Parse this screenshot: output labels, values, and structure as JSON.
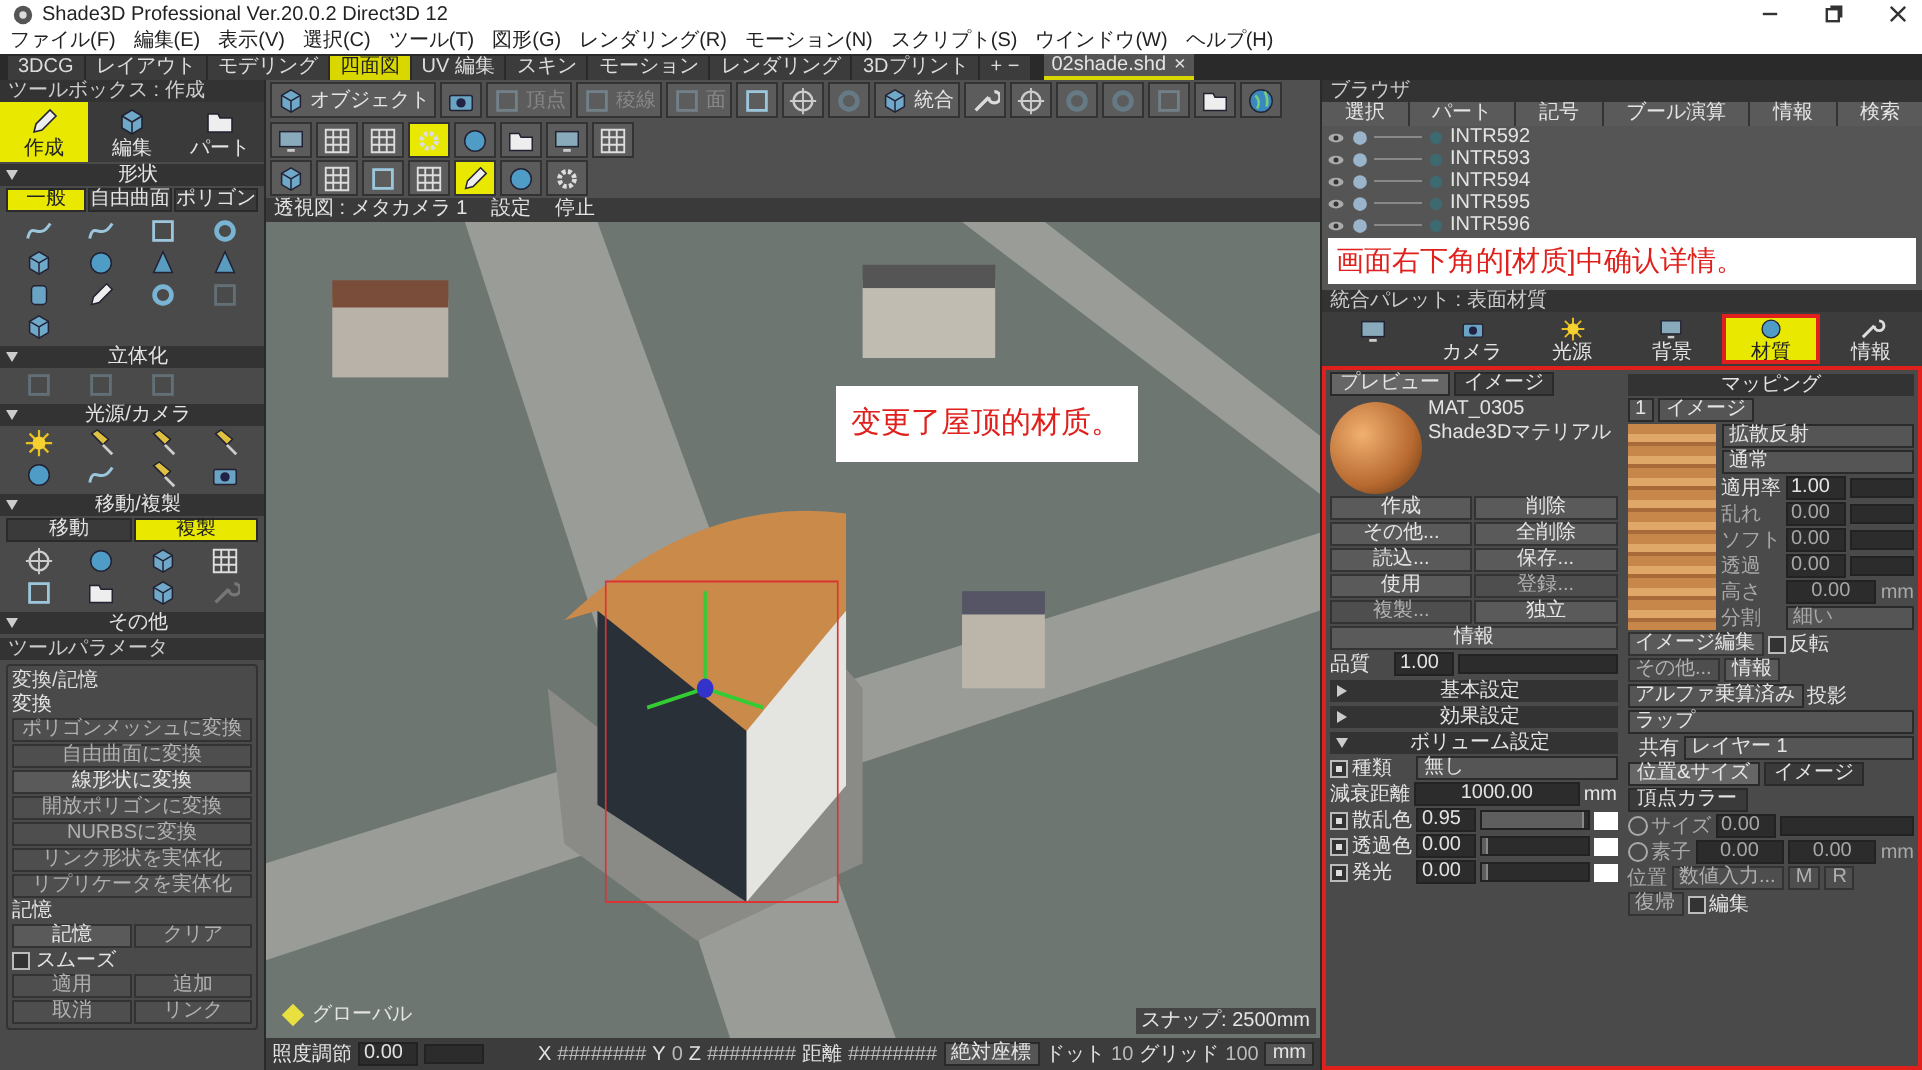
{
  "window": {
    "title": "Shade3D Professional Ver.20.0.2 Direct3D 12"
  },
  "menu": [
    "ファイル(F)",
    "編集(E)",
    "表示(V)",
    "選択(C)",
    "ツール(T)",
    "図形(G)",
    "レンダリング(R)",
    "モーション(N)",
    "スクリプト(S)",
    "ウインドウ(W)",
    "ヘルプ(H)"
  ],
  "mode_tabs": [
    {
      "label": "3DCG",
      "selected": false
    },
    {
      "label": "レイアウト",
      "selected": false
    },
    {
      "label": "モデリング",
      "selected": false
    },
    {
      "label": "四面図",
      "selected": true
    },
    {
      "label": "UV 編集",
      "selected": false
    },
    {
      "label": "スキン",
      "selected": false
    },
    {
      "label": "モーション",
      "selected": false
    },
    {
      "label": "レンダリング",
      "selected": false
    },
    {
      "label": "3Dプリント",
      "selected": false
    }
  ],
  "tab_controls": "+ −",
  "document_tab": {
    "label": "02shade.shd",
    "close": "×"
  },
  "toolbar": {
    "row_1": [
      {
        "label": "オブジェクト",
        "selected": false,
        "disabled": false
      },
      {
        "selected": false,
        "disabled": false
      },
      {
        "label": "頂点",
        "selected": false,
        "disabled": true
      },
      {
        "label": "稜線",
        "selected": false,
        "disabled": true
      },
      {
        "label": "面",
        "selected": false,
        "disabled": true
      },
      {
        "selected": false,
        "disabled": false
      },
      {
        "selected": false,
        "disabled": false
      },
      {
        "selected": false,
        "disabled": true
      },
      {
        "label": "統合",
        "selected": false,
        "disabled": false
      },
      {
        "selected": false,
        "disabled": false
      },
      {
        "selected": false,
        "disabled": false
      },
      {
        "selected": false,
        "disabled": true
      },
      {
        "selected": false,
        "disabled": true
      },
      {
        "selected": false,
        "disabled": true
      },
      {
        "selected": false,
        "disabled": false
      },
      {
        "selected": false,
        "disabled": false
      },
      {
        "selected": false,
        "disabled": false
      },
      {
        "selected": false,
        "disabled": false
      },
      {
        "selected": false,
        "disabled": false
      },
      {
        "selected": true,
        "disabled": false
      },
      {
        "selected": false,
        "disabled": false
      },
      {
        "selected": false,
        "disabled": false
      },
      {
        "selected": false,
        "disabled": false
      },
      {
        "selected": false,
        "disabled": false
      }
    ],
    "row_2": [
      {
        "selected": false,
        "disabled": false
      },
      {
        "selected": false,
        "disabled": false
      },
      {
        "selected": false,
        "disabled": false
      },
      {
        "selected": false,
        "disabled": false
      },
      {
        "selected": true,
        "disabled": false
      },
      {
        "selected": false,
        "disabled": false
      },
      {
        "selected": false,
        "disabled": false
      }
    ]
  },
  "viewport": {
    "header": [
      "透視図 : メタカメラ 1",
      "設定",
      "停止"
    ],
    "callout": "变更了屋顶的材质。",
    "axis_label": "グローバル",
    "snap": "スナップ: 2500mm"
  },
  "status_bar": {
    "label": "照度調節",
    "value": "0.00",
    "coords": [
      {
        "label": "X",
        "value": "########"
      },
      {
        "label": "Y",
        "value": "0"
      },
      {
        "label": "Z",
        "value": "########"
      },
      {
        "label": "距離",
        "value": "########"
      }
    ],
    "mode": "絶対座標",
    "dot_label": "ドット",
    "dot_value": "10",
    "grid_label": "グリッド",
    "grid_value": "100",
    "unit": "mm"
  },
  "toolbox": {
    "title": "ツールボックス : 作成",
    "tabs": [
      {
        "label": "作成",
        "selected": true
      },
      {
        "label": "編集",
        "selected": false
      },
      {
        "label": "パート",
        "selected": false
      }
    ],
    "sections": [
      {
        "title": "形状",
        "expanded": true,
        "subtabs": [
          {
            "label": "一般",
            "selected": true
          },
          {
            "label": "自由曲面",
            "selected": false
          },
          {
            "label": "ポリゴン",
            "selected": false
          }
        ],
        "icons": [
          {
            "disabled": false
          },
          {
            "disabled": false
          },
          {
            "disabled": false
          },
          {
            "disabled": false
          },
          {
            "disabled": false
          },
          {
            "disabled": false
          },
          {
            "disabled": false
          },
          {
            "disabled": false
          },
          {
            "disabled": false
          },
          {
            "disabled": false
          },
          {
            "disabled": false
          },
          {
            "disabled": true
          },
          {
            "disabled": false
          }
        ]
      },
      {
        "title": "立体化",
        "expanded": true,
        "icons": [
          {
            "disabled": true
          },
          {
            "disabled": true
          },
          {
            "disabled": true
          }
        ]
      },
      {
        "title": "光源/カメラ",
        "expanded": true,
        "icons": [
          {
            "disabled": false
          },
          {
            "disabled": false
          },
          {
            "disabled": false
          },
          {
            "disabled": false
          },
          {
            "disabled": false
          },
          {
            "disabled": false
          },
          {
            "disabled": false
          },
          {
            "disabled": false
          }
        ]
      },
      {
        "title": "移動/複製",
        "expanded": true,
        "subtabs": [
          {
            "label": "移動",
            "selected": false
          },
          {
            "label": "複製",
            "selected": true
          }
        ],
        "icons": [
          {
            "disabled": false
          },
          {
            "disabled": false
          },
          {
            "disabled": false
          },
          {
            "disabled": false
          },
          {
            "disabled": false
          },
          {
            "disabled": false
          },
          {
            "disabled": false
          },
          {
            "disabled": true
          }
        ]
      },
      {
        "title": "その他",
        "expanded": true
      }
    ]
  },
  "tool_parameters": {
    "title": "ツールパラメータ",
    "group": "変換/記憶",
    "convert_label": "変換",
    "convert_buttons": [
      {
        "label": "ポリゴンメッシュに変換",
        "disabled": true
      },
      {
        "label": "自由曲面に変換",
        "disabled": true
      },
      {
        "label": "線形状に変換",
        "disabled": false
      },
      {
        "label": "開放ポリゴンに変換",
        "disabled": true
      },
      {
        "label": "NURBSに変換",
        "disabled": true
      },
      {
        "label": "リンク形状を実体化",
        "disabled": true
      },
      {
        "label": "リプリケータを実体化",
        "disabled": true
      }
    ],
    "memory_label": "記憶",
    "memory_buttons": [
      {
        "label": "記憶",
        "disabled": false
      },
      {
        "label": "クリア",
        "disabled": true
      }
    ],
    "smooth": {
      "label": "スムーズ",
      "checked": false
    },
    "extra_buttons": [
      {
        "label": "適用",
        "disabled": true
      },
      {
        "label": "追加",
        "disabled": true
      },
      {
        "label": "取消",
        "disabled": true
      },
      {
        "label": "リンク",
        "disabled": true
      }
    ]
  },
  "browser": {
    "title": "ブラウザ",
    "columns": [
      "選択",
      "パート",
      "記号",
      "ブール演算",
      "情報",
      "検索"
    ],
    "rows": [
      "INTR592",
      "INTR593",
      "INTR594",
      "INTR595",
      "INTR596"
    ],
    "callout": "画面右下角的[材质]中确认详情。"
  },
  "palette": {
    "title": "統合パレット : 表面材質",
    "tabs": [
      {
        "selected": false
      },
      {
        "label": "カメラ",
        "selected": false
      },
      {
        "label": "光源",
        "selected": false
      },
      {
        "label": "背景",
        "selected": false
      },
      {
        "label": "材質",
        "selected": true
      },
      {
        "label": "情報",
        "selected": false
      }
    ]
  },
  "material": {
    "tabs": [
      {
        "label": "プレビュー",
        "selected": true
      },
      {
        "label": "イメージ",
        "selected": false
      }
    ],
    "name": "MAT_0305",
    "type": "Shade3Dマテリアル",
    "buttons": [
      {
        "label": "作成",
        "disabled": false
      },
      {
        "label": "削除",
        "disabled": false
      },
      {
        "label": "その他...",
        "disabled": false
      },
      {
        "label": "全削除",
        "disabled": false
      },
      {
        "label": "読込...",
        "disabled": false
      },
      {
        "label": "保存...",
        "disabled": false
      },
      {
        "label": "使用",
        "disabled": false
      },
      {
        "label": "登録...",
        "disabled": true
      },
      {
        "label": "複製...",
        "disabled": true
      },
      {
        "label": "独立",
        "disabled": false
      }
    ],
    "info_button": "情報",
    "quality_label": "品質",
    "quality_value": "1.00",
    "sections": [
      {
        "title": "基本設定",
        "expanded": false
      },
      {
        "title": "効果設定",
        "expanded": false
      },
      {
        "title": "ボリューム設定",
        "expanded": true
      }
    ],
    "volume": [
      {
        "kind": "select",
        "checked": true,
        "label": "種類",
        "value": "無し"
      },
      {
        "kind": "field",
        "label": "減衰距離",
        "value": "1000.00",
        "unit": "mm"
      },
      {
        "kind": "slider",
        "checked": true,
        "label": "散乱色",
        "value": "0.95",
        "level": 0.95
      },
      {
        "kind": "slider",
        "checked": true,
        "label": "透過色",
        "value": "0.00",
        "level": 0
      },
      {
        "kind": "slider",
        "checked": true,
        "label": "発光",
        "value": "0.00",
        "level": 0
      }
    ],
    "mapping_title": "マッピング",
    "layer": "1",
    "layer_type": "イメージ",
    "channel": "拡散反射",
    "blend": "通常",
    "map_rows": [
      {
        "kind": "slider",
        "label": "適用率",
        "value": "1.00",
        "disabled": false
      },
      {
        "kind": "slider",
        "label": "乱れ",
        "value": "0.00",
        "disabled": true
      },
      {
        "kind": "slider",
        "label": "ソフト",
        "value": "0.00",
        "disabled": true
      },
      {
        "kind": "slider",
        "label": "透過",
        "value": "0.00",
        "disabled": true
      },
      {
        "kind": "field",
        "label": "高さ",
        "value": "0.00",
        "unit": "mm",
        "disabled": true
      },
      {
        "kind": "select",
        "label": "分割",
        "value": "細い",
        "disabled": true
      }
    ],
    "image_edit": "イメージ編集",
    "invert": {
      "label": "反転",
      "checked": false
    },
    "other": "その他...",
    "info": "情報",
    "alpha": "アルファ乗算済み",
    "projection": {
      "label": "投影",
      "value": "ラップ"
    },
    "share": {
      "label": "共有",
      "value": "レイヤー 1"
    },
    "bottom_tabs": [
      {
        "label": "位置&サイズ",
        "selected": true
      },
      {
        "label": "イメージ",
        "selected": false
      },
      {
        "label": "頂点カラー",
        "selected": false
      }
    ],
    "size_selected": false,
    "element_selected": false,
    "size_label": "サイズ",
    "size_value": "0.00",
    "element_label": "素子",
    "element_value_1": "0.00",
    "element_value_2": "0.00",
    "element_unit": "mm",
    "position_label": "位置",
    "position_buttons": [
      "数値入力...",
      "M",
      "R",
      "復帰"
    ],
    "edit": {
      "label": "編集",
      "checked": false
    }
  }
}
